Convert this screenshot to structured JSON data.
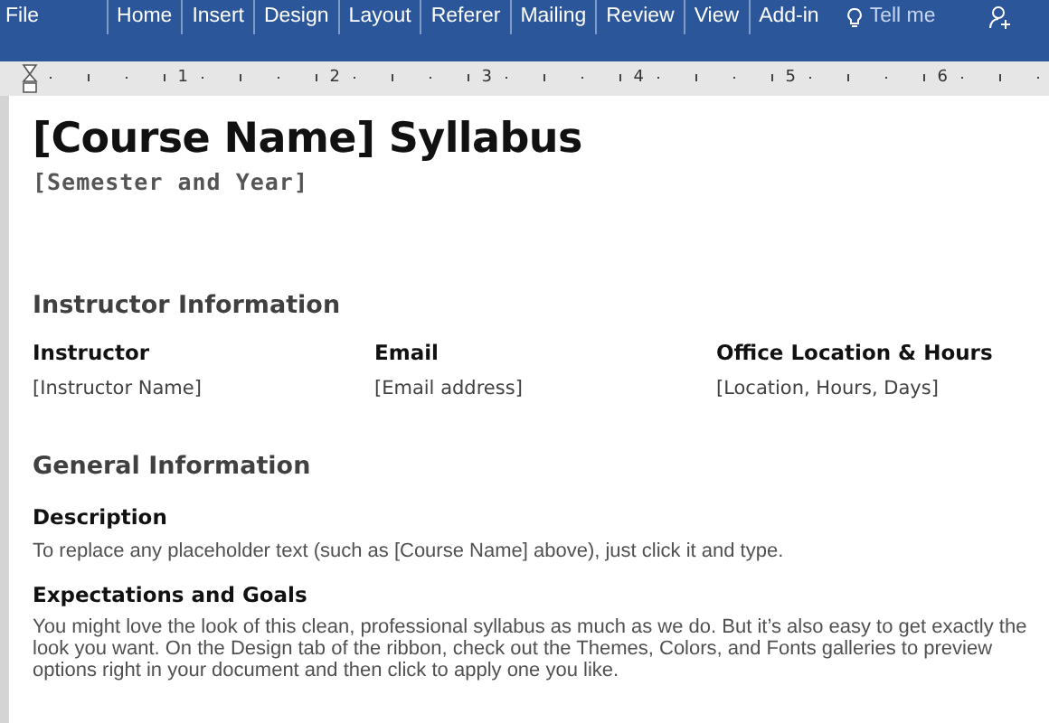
{
  "ribbon": {
    "tabs": [
      {
        "label": "File",
        "selected": false
      },
      {
        "label": "Home",
        "selected": false
      },
      {
        "label": "Insert",
        "selected": false
      },
      {
        "label": "Design",
        "selected": false
      },
      {
        "label": "Layout",
        "selected": false
      },
      {
        "label": "Referer",
        "selected": false
      },
      {
        "label": "Mailing",
        "selected": false
      },
      {
        "label": "Review",
        "selected": false
      },
      {
        "label": "View",
        "selected": false
      },
      {
        "label": "Add-in",
        "selected": false
      }
    ],
    "tell_me": "Tell me"
  },
  "ruler": {
    "numbers": [
      "1",
      "2",
      "3",
      "4",
      "5",
      "6"
    ]
  },
  "document": {
    "title": "[Course Name] Syllabus",
    "subtitle": "[Semester and Year]",
    "sections": [
      {
        "heading": "Instructor Information",
        "kind": "columns",
        "columns": [
          {
            "label": "Instructor",
            "value": "[Instructor Name]"
          },
          {
            "label": "Email",
            "value": "[Email address]"
          },
          {
            "label": "Office Location & Hours",
            "value": "[Location, Hours, Days]"
          }
        ]
      },
      {
        "heading": "General Information",
        "kind": "paragraphs",
        "items": [
          {
            "label": "Description",
            "text": "To replace any placeholder text (such as [Course Name] above), just click it and type."
          },
          {
            "label": "Expectations and Goals",
            "text": "You might love the look of this clean, professional syllabus as much as we do. But it’s also easy to get exactly the look you want. On the Design tab of the ribbon, check out the Themes, Colors, and Fonts galleries to preview options right in your document and then click to apply one you like."
          }
        ]
      }
    ]
  }
}
